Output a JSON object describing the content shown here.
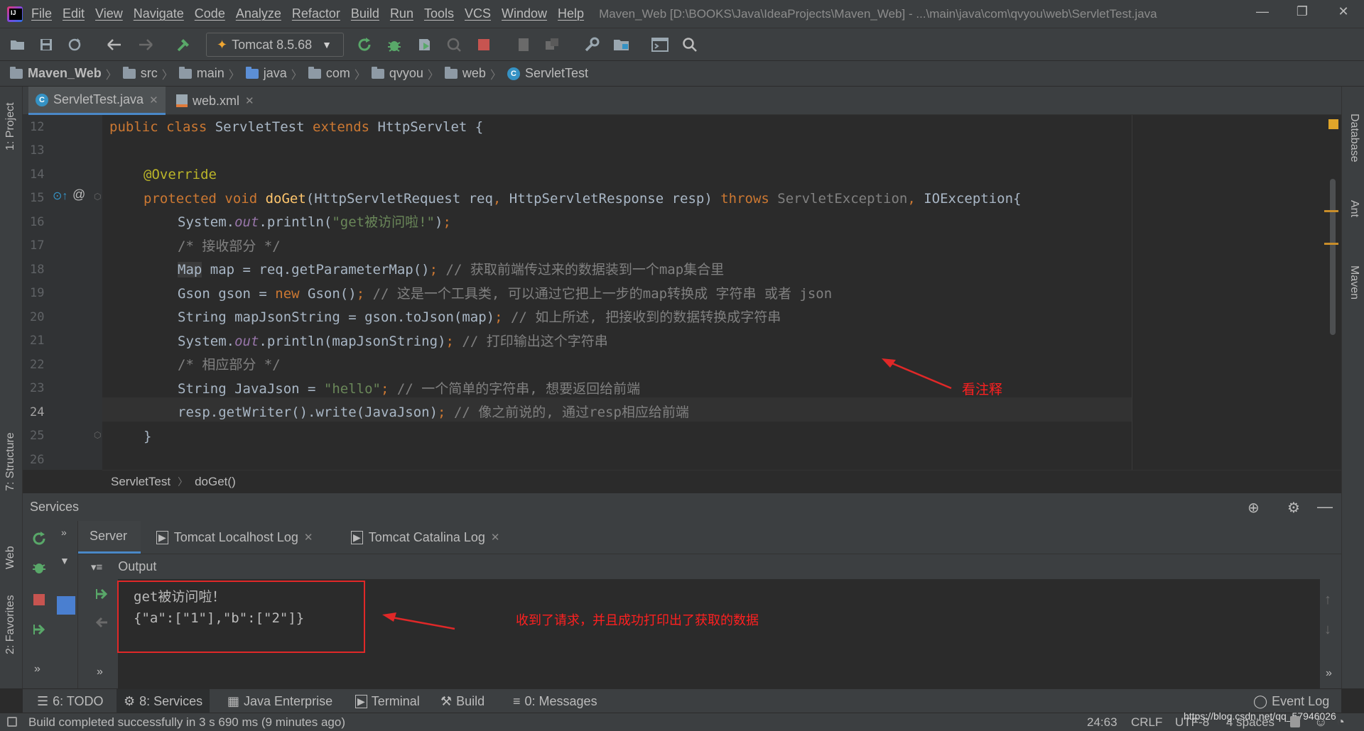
{
  "menu": {
    "items": [
      "File",
      "Edit",
      "View",
      "Navigate",
      "Code",
      "Analyze",
      "Refactor",
      "Build",
      "Run",
      "Tools",
      "VCS",
      "Window",
      "Help"
    ],
    "window_title": "Maven_Web [D:\\BOOKS\\Java\\IdeaProjects\\Maven_Web] - ...\\main\\java\\com\\qvyou\\web\\ServletTest.java"
  },
  "toolbar": {
    "run_config": "Tomcat 8.5.68"
  },
  "breadcrumb": [
    "Maven_Web",
    "src",
    "main",
    "java",
    "com",
    "qvyou",
    "web",
    "ServletTest"
  ],
  "editor_tabs": [
    {
      "label": "ServletTest.java",
      "active": true
    },
    {
      "label": "web.xml",
      "active": false
    }
  ],
  "side_tools": {
    "left": [
      "1: Project",
      "7: Structure",
      "Web",
      "2: Favorites"
    ],
    "right": [
      "Database",
      "Ant",
      "Maven"
    ]
  },
  "code": {
    "line_numbers": [
      "12",
      "13",
      "14",
      "15",
      "16",
      "17",
      "18",
      "19",
      "20",
      "21",
      "22",
      "23",
      "24",
      "25",
      "26"
    ],
    "current_line": "24"
  },
  "editor_breadcrumb": {
    "class_name": "ServletTest",
    "method": "doGet()"
  },
  "annotations": {
    "code_note": "看注释",
    "console_note": "收到了请求，并且成功打印出了获取的数据"
  },
  "services": {
    "title": "Services",
    "tabs": [
      "Server",
      "Tomcat Localhost Log",
      "Tomcat Catalina Log"
    ],
    "output_label": "Output",
    "console_lines": [
      "get被访问啦！",
      "{\"a\":[\"1\"],\"b\":[\"2\"]}"
    ]
  },
  "bottom_tools": [
    {
      "label": "6: TODO",
      "active": false
    },
    {
      "label": "8: Services",
      "active": true
    },
    {
      "label": "Java Enterprise",
      "active": false
    },
    {
      "label": "Terminal",
      "active": false
    },
    {
      "label": "Build",
      "active": false
    },
    {
      "label": "0: Messages",
      "active": false
    }
  ],
  "event_log": "Event Log",
  "status": {
    "message": "Build completed successfully in 3 s 690 ms (9 minutes ago)",
    "position": "24:63",
    "line_sep": "CRLF",
    "encoding": "UTF-8",
    "indent": "4 spaces",
    "watermark": "https://blog.csdn.net/qq_57946026"
  },
  "colors": {
    "keyword": "#cc7832",
    "string": "#6a8759",
    "comment": "#808080",
    "annotation": "#bbb529",
    "method": "#ffc66d",
    "static_field": "#9876aa",
    "highlight_red": "#e02828"
  }
}
